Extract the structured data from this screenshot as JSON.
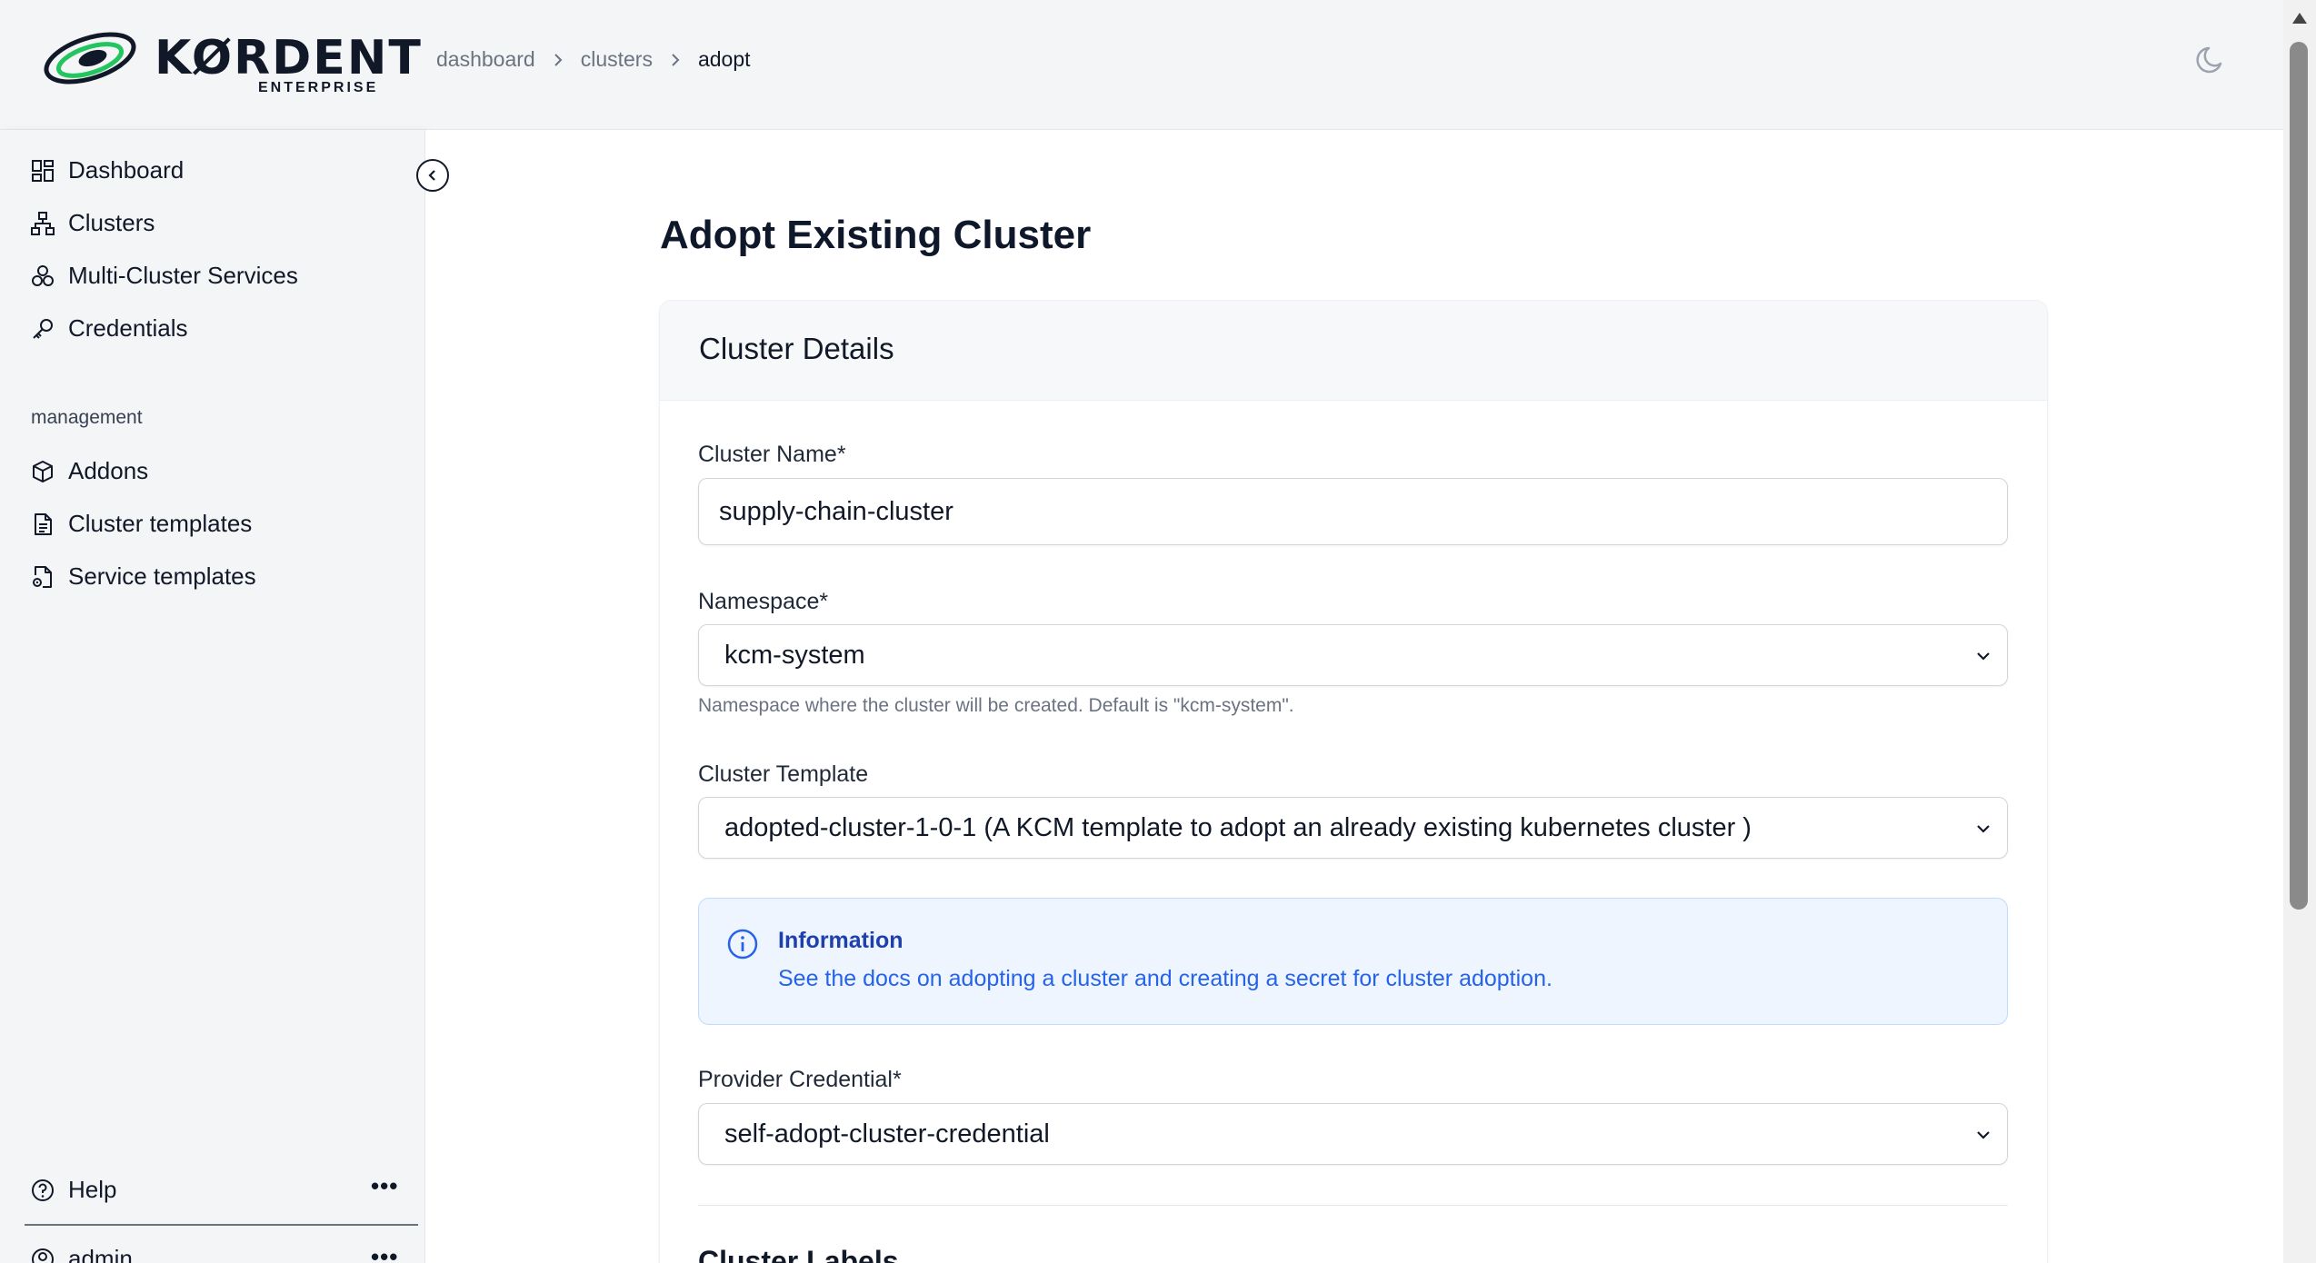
{
  "brand": {
    "name": "KØRDENT",
    "subtitle": "ENTERPRISE"
  },
  "breadcrumb": {
    "items": [
      "dashboard",
      "clusters"
    ],
    "current": "adopt"
  },
  "sidebar": {
    "main_items": [
      {
        "label": "Dashboard",
        "icon": "dashboard-icon"
      },
      {
        "label": "Clusters",
        "icon": "clusters-icon"
      },
      {
        "label": "Multi-Cluster Services",
        "icon": "services-icon"
      },
      {
        "label": "Credentials",
        "icon": "key-icon"
      }
    ],
    "section_label": "management",
    "management_items": [
      {
        "label": "Addons",
        "icon": "package-icon"
      },
      {
        "label": "Cluster templates",
        "icon": "file-icon"
      },
      {
        "label": "Service templates",
        "icon": "file-gear-icon"
      }
    ],
    "footer": {
      "help": "Help",
      "user": "admin",
      "more": "•••"
    }
  },
  "page": {
    "title": "Adopt Existing Cluster"
  },
  "card": {
    "title": "Cluster Details"
  },
  "form": {
    "cluster_name": {
      "label": "Cluster Name*",
      "value": "supply-chain-cluster"
    },
    "namespace": {
      "label": "Namespace*",
      "value": "kcm-system",
      "hint": "Namespace where the cluster will be created. Default is \"kcm-system\"."
    },
    "cluster_template": {
      "label": "Cluster Template",
      "value": "adopted-cluster-1-0-1 (A KCM template to adopt an already existing kubernetes cluster )"
    },
    "info": {
      "title": "Information",
      "prefix": "See the docs on ",
      "link1": "adopting a cluster",
      "middle": " and ",
      "link2": "creating a secret for cluster adoption",
      "suffix": "."
    },
    "provider_credential": {
      "label": "Provider Credential*",
      "value": "self-adopt-cluster-credential"
    },
    "next_section": "Cluster Labels"
  },
  "colors": {
    "accent": "#2563eb",
    "info_bg": "#eef5fe",
    "sidebar_bg": "#f4f5f7"
  }
}
